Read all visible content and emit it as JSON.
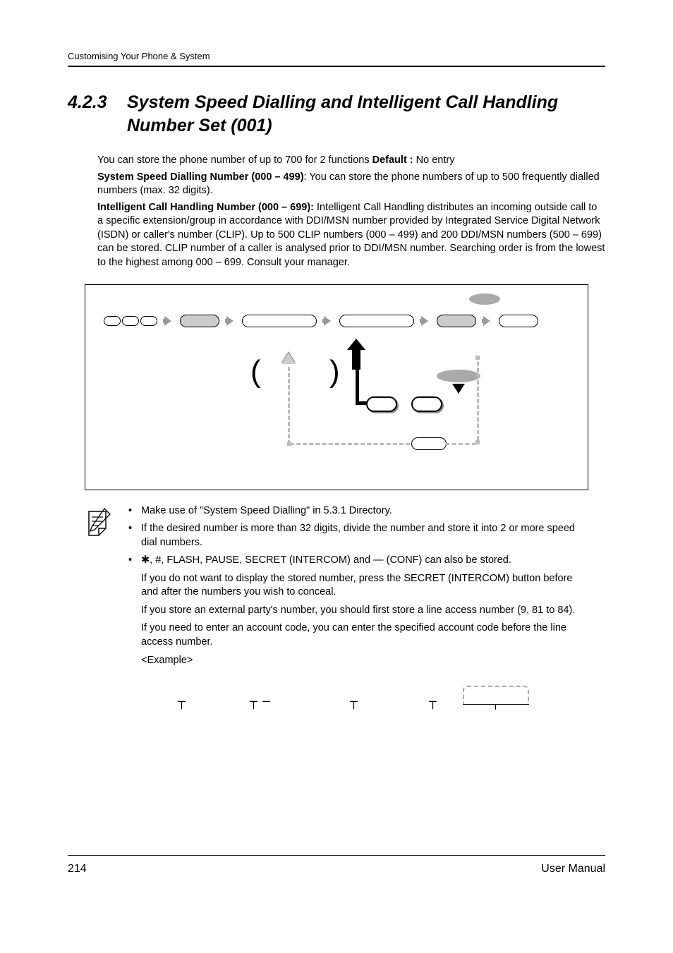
{
  "header": {
    "breadcrumb": "Customising Your Phone & System"
  },
  "section": {
    "number": "4.2.3",
    "title": "System Speed Dialling and Intelligent Call Handling Number Set (001)"
  },
  "body": {
    "p1_prefix": "You can store the phone number of up to 700 for 2 functions ",
    "p1_default_label": "Default :",
    "p1_default_value": " No entry",
    "p2_label": "System Speed Dialling Number (000 – 499)",
    "p2_text": ": You can store the phone numbers of up to 500 frequently dialled numbers (max. 32 digits).",
    "p3_label": "Intelligent Call Handling Number (000 – 699):",
    "p3_text": " Intelligent Call Handling distributes an incoming outside call to a specific extension/group in accordance with DDI/MSN number provided by Integrated Service Digital Network (ISDN) or caller's number (CLIP). Up to 500 CLIP numbers (000 – 499) and 200 DDI/MSN numbers (500 – 699) can be stored. CLIP number of a caller is analysed prior to DDI/MSN number. Searching order is from the lowest to the highest among 000 – 699. Consult your manager."
  },
  "notes": {
    "n1": "Make use of \"System Speed Dialling\" in 5.3.1    Directory.",
    "n2": "If the desired number is more than 32 digits, divide the number and store it into 2 or more speed dial numbers.",
    "n3_symbols": ", #",
    "n3_rest": ", FLASH, PAUSE, SECRET (INTERCOM) and — (CONF) can also be stored.",
    "n3_c1": "If you do not want to display the stored number, press the SECRET (INTERCOM) button before and after the numbers you wish to conceal.",
    "n3_c2": "If you store an external party's number, you should first store a line access number (9, 81 to 84).",
    "n3_c3": "If you need to enter an account code, you can enter the specified account code before the line access number.",
    "n3_c4": "<Example>"
  },
  "footer": {
    "page_number": "214",
    "doc_label": "User Manual"
  }
}
